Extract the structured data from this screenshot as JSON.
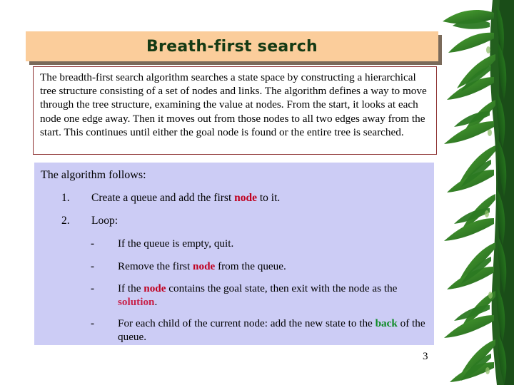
{
  "slide": {
    "title": "Breath-first search",
    "page_number": "3",
    "intro_paragraph": "The breadth-first search algorithm searches a state space by constructing a hierarchical tree structure consisting of a set of nodes and links. The algorithm defines a way to move through the tree structure, examining the value at nodes. From the start, it looks at each node one edge away. Then it moves out from those nodes to all two edges away from the start. This continues until either the goal node is found or the entire tree is searched.",
    "lead_in": "The algorithm follows:",
    "steps": [
      {
        "marker": "1.",
        "parts": [
          {
            "text": "Create a queue and add the first ",
            "style": "plain"
          },
          {
            "text": "node",
            "style": "keyword-node"
          },
          {
            "text": " to it.",
            "style": "plain"
          }
        ]
      },
      {
        "marker": "2.",
        "parts": [
          {
            "text": "Loop:",
            "style": "plain"
          }
        ]
      }
    ],
    "substeps": [
      {
        "marker": "-",
        "parts": [
          {
            "text": "If the queue is empty, quit.",
            "style": "plain"
          }
        ]
      },
      {
        "marker": "-",
        "parts": [
          {
            "text": "Remove the first ",
            "style": "plain"
          },
          {
            "text": "node",
            "style": "keyword-node"
          },
          {
            "text": " from the queue.",
            "style": "plain"
          }
        ]
      },
      {
        "marker": "-",
        "parts": [
          {
            "text": "If the ",
            "style": "plain"
          },
          {
            "text": "node",
            "style": "keyword-node"
          },
          {
            "text": " contains the goal state, then exit with the node as the ",
            "style": "plain"
          },
          {
            "text": "solution",
            "style": "keyword-solution"
          },
          {
            "text": ".",
            "style": "plain"
          }
        ]
      },
      {
        "marker": "-",
        "parts": [
          {
            "text": "For each child of the current node: add the new state to the ",
            "style": "plain"
          },
          {
            "text": "back",
            "style": "keyword-back"
          },
          {
            "text": " of the queue.",
            "style": "plain"
          }
        ]
      }
    ],
    "colors": {
      "title_background": "#FBCD9B",
      "title_text": "#143A14",
      "title_shadow": "#7A6A5A",
      "intro_border": "#8C2F2F",
      "content_background": "#CCCCF5",
      "keyword_node": "#C00020",
      "keyword_solution": "#C8224B",
      "keyword_back": "#0B8A22",
      "foliage_dark": "#1D5C1C",
      "foliage_mid": "#2E8A23",
      "foliage_light": "#4FA832"
    },
    "decoration": {
      "name": "bamboo-foliage-image",
      "description": "bamboo leaves photograph along right edge"
    }
  }
}
